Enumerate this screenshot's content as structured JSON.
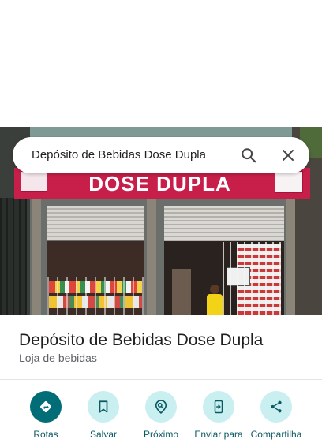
{
  "search": {
    "query": "Depósito de Bebidas Dose Dupla"
  },
  "sign": {
    "text": "DOSE DUPLA"
  },
  "place": {
    "name": "Depósito de Bebidas Dose Dupla",
    "category": "Loja de bebidas"
  },
  "actions": [
    {
      "label": "Rotas",
      "icon": "directions-icon"
    },
    {
      "label": "Salvar",
      "icon": "bookmark-icon"
    },
    {
      "label": "Próximo",
      "icon": "nearby-icon"
    },
    {
      "label": "Enviar para",
      "icon": "send-to-phone-icon"
    },
    {
      "label": "Compartilha",
      "icon": "share-icon"
    }
  ],
  "colors": {
    "accent": "#006d77",
    "action_bg": "#c9eff1",
    "sign": "#c81e4a"
  }
}
